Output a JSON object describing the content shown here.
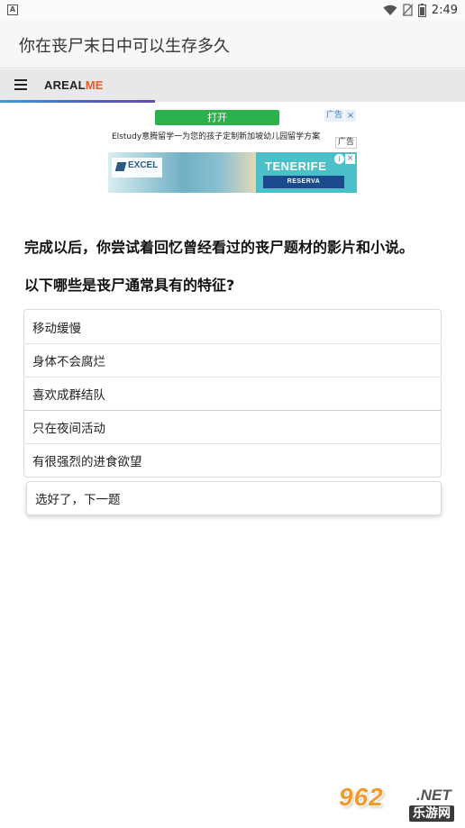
{
  "status_bar": {
    "app_badge": "A",
    "time": "2:49"
  },
  "title_bar": {
    "title": "你在丧尸末日中可以生存多久"
  },
  "nav": {
    "brand_part1": "AREAL",
    "brand_part2": "ME"
  },
  "ad_top": {
    "button_label": "打开",
    "badge": "广告",
    "close": "×",
    "text": "Elstudy意腾留学一为您的孩子定制新加坡幼儿园留学方案"
  },
  "ad_banner": {
    "badge": "广告",
    "logo_text": "EXCEL",
    "title": "TENERIFE",
    "cta": "RESERVA",
    "info": "i",
    "close": "×"
  },
  "quiz": {
    "intro": "完成以后，你尝试着回忆曾经看过的丧尸题材的影片和小说。",
    "question": "以下哪些是丧尸通常具有的特征?",
    "options": [
      "移动缓慢",
      "身体不会腐烂",
      "喜欢成群结队",
      "只在夜间活动",
      "有很强烈的进食欲望"
    ],
    "next_button": "选好了，下一题"
  },
  "watermark": {
    "big": "962",
    "net": ".NET",
    "sub": "乐游网"
  },
  "colors": {
    "brand_accent": "#ef5a24",
    "ad_button": "#2bb24c",
    "watermark_orange": "#f39a2b"
  }
}
